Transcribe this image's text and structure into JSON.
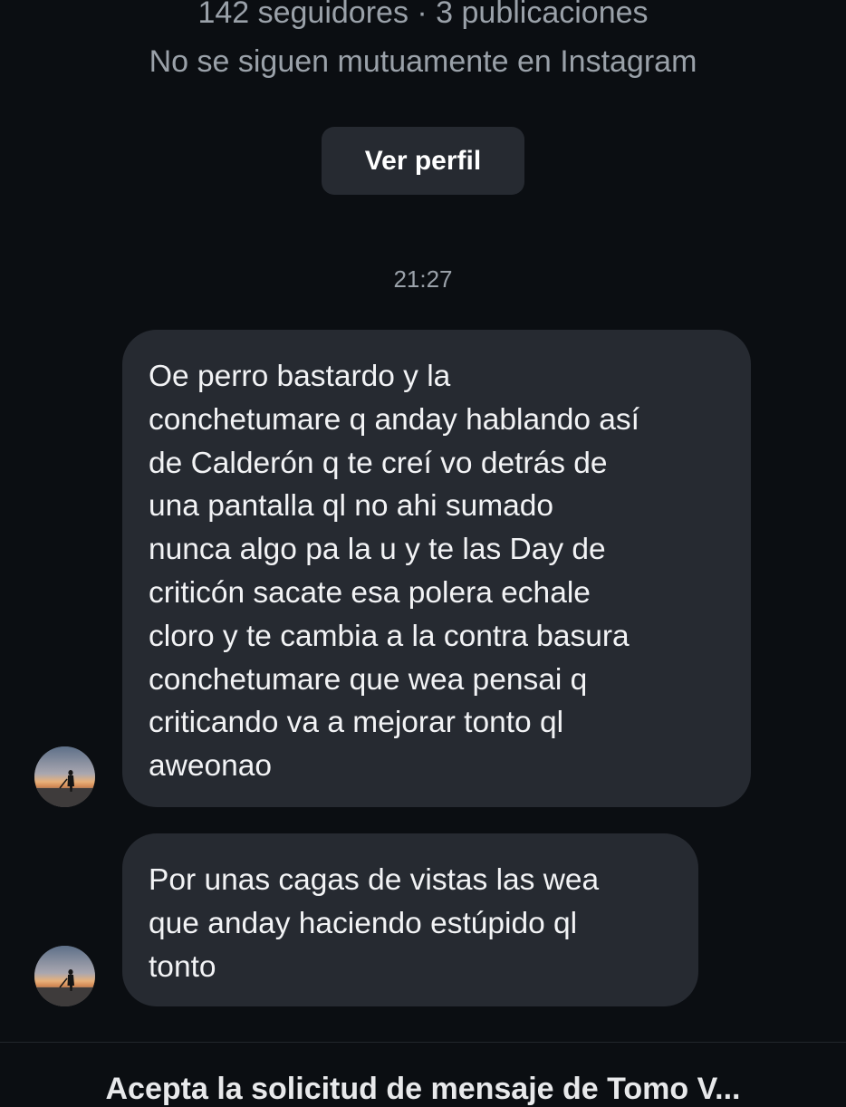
{
  "profile": {
    "stats": "142 seguidores · 3 publicaciones",
    "mutual_note": "No se siguen mutuamente en Instagram",
    "view_profile_label": "Ver perfil"
  },
  "thread": {
    "timestamp": "21:27",
    "messages": [
      {
        "lines": [
          "Oe perro bastardo y la",
          "conchetumare q anday hablando así",
          "de Calderón q te creí vo detrás de",
          "una pantalla ql no ahi sumado",
          "nunca algo pa la u y te las Day de",
          "criticón sacate esa polera echale",
          "cloro y te cambia a la contra basura",
          "conchetumare que wea pensai q",
          "criticando va a mejorar tonto ql",
          "aweonao"
        ]
      },
      {
        "lines": [
          "Por unas cagas de vistas las wea",
          "que anday haciendo estúpido ql",
          "tonto"
        ]
      }
    ]
  },
  "footer": {
    "note": "Acepta la solicitud de mensaje de Tomo V..."
  },
  "colors": {
    "background": "#0b0e12",
    "bubble": "#262a31",
    "muted_text": "#9aa1a9"
  }
}
